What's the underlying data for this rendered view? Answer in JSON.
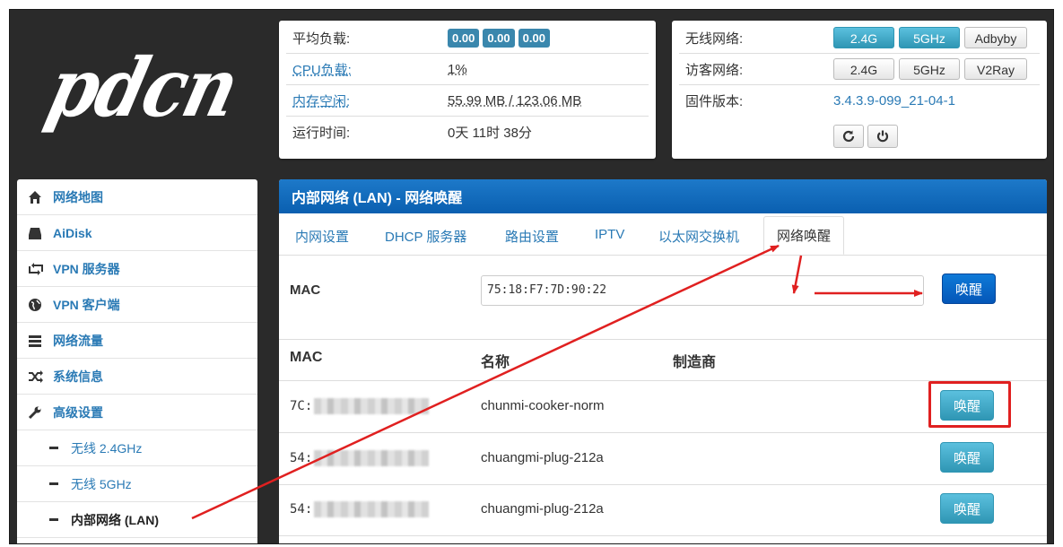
{
  "logo": {
    "text": "pdcn"
  },
  "status": {
    "load_label": "平均负载:",
    "load_values": [
      "0.00",
      "0.00",
      "0.00"
    ],
    "cpu_label": "CPU负载:",
    "cpu_value": "1%",
    "mem_label": "内存空闲:",
    "mem_value": "55.99 MB / 123.06 MB",
    "uptime_label": "运行时间:",
    "uptime_value": "0天 11时 38分"
  },
  "network": {
    "wireless_label": "无线网络:",
    "wireless_buttons": [
      "2.4G",
      "5GHz",
      "Adbyby"
    ],
    "guest_label": "访客网络:",
    "guest_buttons": [
      "2.4G",
      "5GHz",
      "V2Ray"
    ],
    "firmware_label": "固件版本:",
    "firmware_value": "3.4.3.9-099_21-04-1"
  },
  "sidebar": {
    "items": [
      {
        "label": "网络地图",
        "icon": "home-icon"
      },
      {
        "label": "AiDisk",
        "icon": "disk-icon"
      },
      {
        "label": "VPN 服务器",
        "icon": "vpn-server-icon"
      },
      {
        "label": "VPN 客户端",
        "icon": "globe-icon"
      },
      {
        "label": "网络流量",
        "icon": "traffic-icon"
      },
      {
        "label": "系统信息",
        "icon": "shuffle-icon"
      },
      {
        "label": "高级设置",
        "icon": "wrench-icon"
      }
    ],
    "subitems": [
      "无线 2.4GHz",
      "无线 5GHz",
      "内部网络 (LAN)"
    ]
  },
  "main": {
    "title": "内部网络 (LAN) - 网络唤醒",
    "tabs": [
      "内网设置",
      "DHCP 服务器",
      "路由设置",
      "IPTV",
      "以太网交换机",
      "网络唤醒"
    ],
    "mac_label": "MAC",
    "mac_input_value": "75:18:F7:7D:90:22",
    "wake_label": "唤醒",
    "columns": [
      "MAC",
      "名称",
      "制造商"
    ],
    "rows": [
      {
        "mac": "7C:",
        "name": "chunmi-cooker-norm",
        "vendor": ""
      },
      {
        "mac": "54:",
        "name": "chuangmi-plug-212a",
        "vendor": ""
      },
      {
        "mac": "54:",
        "name": "chuangmi-plug-212a",
        "vendor": ""
      }
    ]
  },
  "colors": {
    "accent": "#2a7ab5",
    "header_blue": "#0a5fb0",
    "annotation_red": "#e02020"
  }
}
